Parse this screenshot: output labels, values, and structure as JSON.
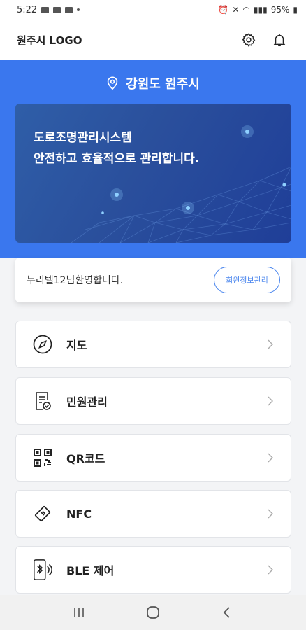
{
  "status_bar": {
    "time": "5:22",
    "battery": "95%"
  },
  "header": {
    "logo": "원주시 LOGO"
  },
  "hero": {
    "location": "강원도 원주시",
    "banner_line1": "도로조명관리시스템",
    "banner_line2": "안전하고 효율적으로 관리합니다."
  },
  "welcome": {
    "user_name": "누리텔12",
    "suffix": "님환영합니다.",
    "member_button": "회원정보관리"
  },
  "menu": [
    {
      "label": "지도",
      "icon": "compass-icon"
    },
    {
      "label": "민원관리",
      "icon": "complaint-document-icon"
    },
    {
      "label": "QR코드",
      "icon": "qr-code-icon"
    },
    {
      "label": "NFC",
      "icon": "nfc-tag-icon"
    },
    {
      "label": "BLE 제어",
      "icon": "bluetooth-phone-icon"
    }
  ],
  "colors": {
    "hero_blue": "#3a77ee",
    "accent": "#4a86ee"
  }
}
